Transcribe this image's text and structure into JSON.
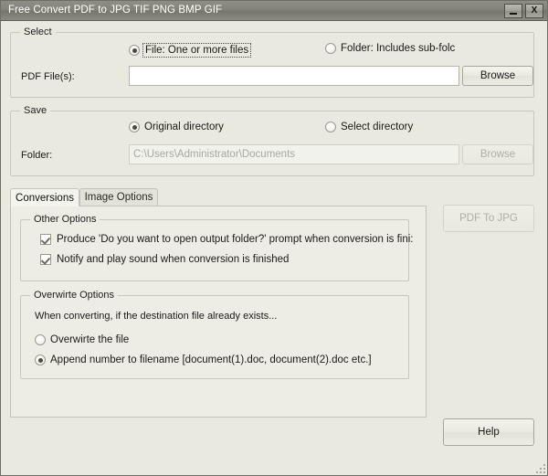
{
  "window": {
    "title": "Free Convert PDF to JPG TIF PNG BMP GIF",
    "minimize_label": "",
    "close_label": "X"
  },
  "select_group": {
    "title": "Select",
    "radio_file": "File:  One or more files",
    "radio_folder": "Folder: Includes sub-folc",
    "selected": "file",
    "file_label": "PDF File(s):",
    "file_value": "",
    "browse_label": "Browse"
  },
  "save_group": {
    "title": "Save",
    "radio_original": "Original directory",
    "radio_select": "Select directory",
    "selected": "original",
    "folder_label": "Folder:",
    "folder_value": "C:\\Users\\Administrator\\Documents",
    "browse_label": "Browse"
  },
  "tabs": [
    {
      "label": "Conversions",
      "active": true
    },
    {
      "label": "Image Options",
      "active": false
    }
  ],
  "other_options": {
    "title": "Other Options",
    "items": [
      {
        "label": "Produce 'Do you want to open output folder?' prompt when conversion is fini:",
        "checked": true
      },
      {
        "label": "Notify and play sound when conversion is finished",
        "checked": true
      }
    ]
  },
  "overwrite_options": {
    "title": "Overwirte Options",
    "description": "When converting, if the destination file already exists...",
    "items": [
      {
        "label": "Overwirte the file",
        "checked": false
      },
      {
        "label": "Append number to filename  [document(1).doc, document(2).doc etc.]",
        "checked": true
      }
    ]
  },
  "actions": {
    "convert_label": "PDF To JPG",
    "convert_enabled": false,
    "help_label": "Help",
    "help_enabled": true
  },
  "colors": {
    "window_background": "#e9e9e0",
    "titlebar": "#83837a",
    "panel_background": "#edede5",
    "field_background": "#ffffff",
    "disabled_text": "#a8a89e"
  }
}
